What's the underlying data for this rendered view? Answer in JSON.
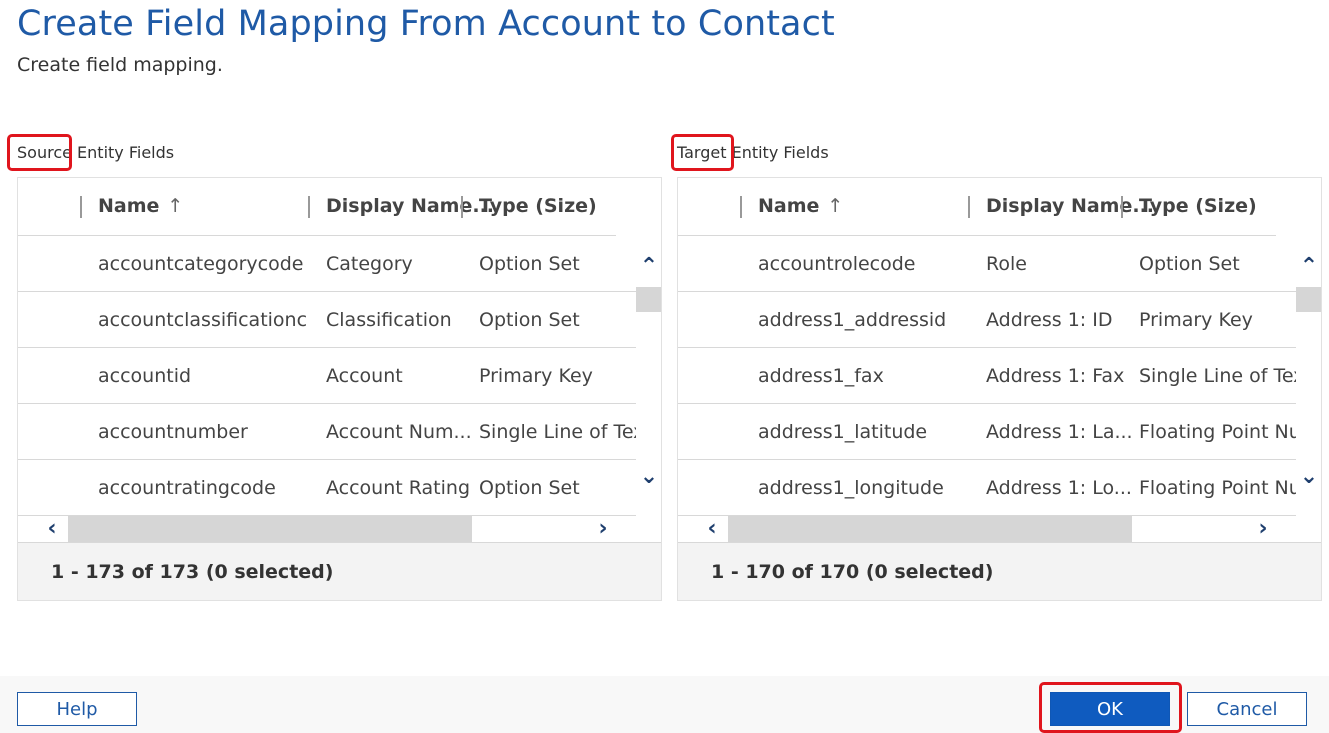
{
  "dialog": {
    "title": "Create Field Mapping From Account to Contact",
    "subtitle": "Create field mapping."
  },
  "source": {
    "label": "Source Entity Fields",
    "columns": [
      "Name",
      "Display Name...",
      "Type (Size)"
    ],
    "sort_arrow": "↑",
    "rows": [
      {
        "name": "accountcategorycode",
        "display": "Category",
        "type": "Option Set"
      },
      {
        "name": "accountclassificationc...",
        "display": "Classification",
        "type": "Option Set"
      },
      {
        "name": "accountid",
        "display": "Account",
        "type": "Primary Key"
      },
      {
        "name": "accountnumber",
        "display": "Account Num...",
        "type": "Single Line of Text"
      },
      {
        "name": "accountratingcode",
        "display": "Account Rating",
        "type": "Option Set"
      }
    ],
    "footer": "1 - 173 of 173 (0 selected)"
  },
  "target": {
    "label": "Target Entity Fields",
    "columns": [
      "Name",
      "Display Name...",
      "Type (Size)"
    ],
    "sort_arrow": "↑",
    "rows": [
      {
        "name": "accountrolecode",
        "display": "Role",
        "type": "Option Set"
      },
      {
        "name": "address1_addressid",
        "display": "Address 1: ID",
        "type": "Primary Key"
      },
      {
        "name": "address1_fax",
        "display": "Address 1: Fax",
        "type": "Single Line of Text"
      },
      {
        "name": "address1_latitude",
        "display": "Address 1: La...",
        "type": "Floating Point Nur"
      },
      {
        "name": "address1_longitude",
        "display": "Address 1: Lo...",
        "type": "Floating Point Nur"
      }
    ],
    "footer": "1 - 170 of 170 (0 selected)"
  },
  "buttons": {
    "help": "Help",
    "ok": "OK",
    "cancel": "Cancel"
  },
  "colors": {
    "title": "#1f5aa6",
    "primary": "#0f5bbf",
    "highlight": "#e0151d"
  }
}
